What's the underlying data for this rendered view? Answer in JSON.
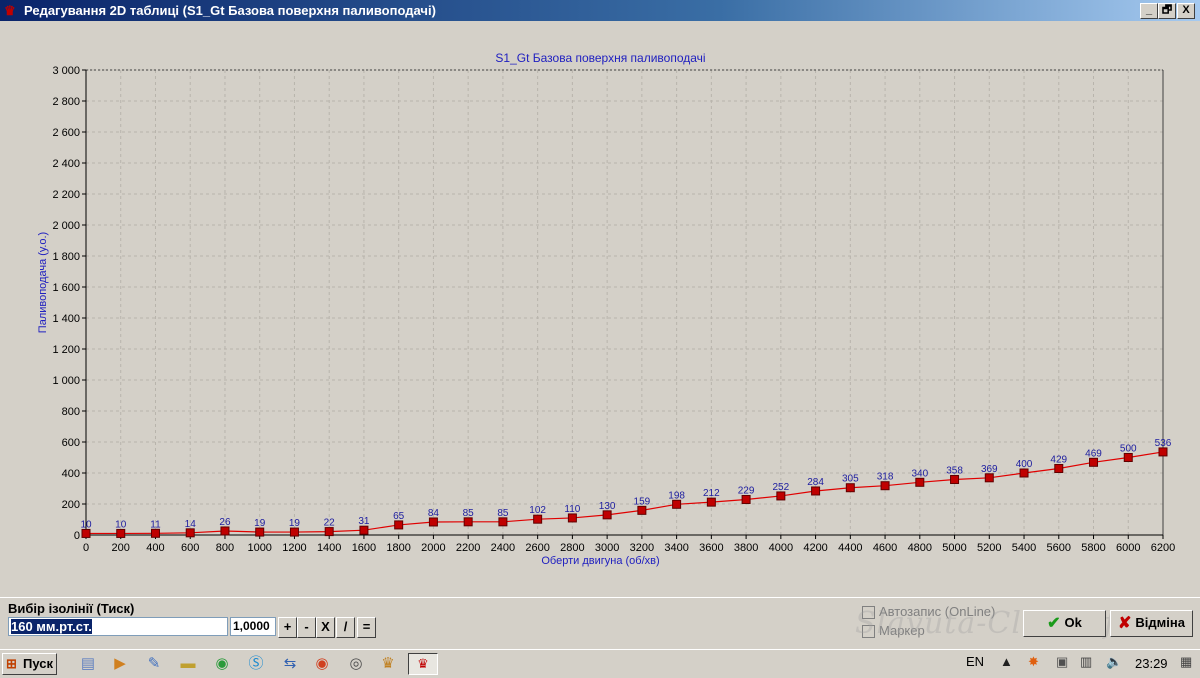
{
  "window": {
    "title": "Редагування 2D таблиці (S1_Gt Базова поверхня паливоподачі)",
    "icon": "crown-icon",
    "buttons": [
      "_",
      "🗗",
      "X"
    ]
  },
  "chart_data": {
    "type": "line",
    "title": "S1_Gt Базова поверхня паливоподачі",
    "xlabel": "Оберти двигуна (об/хв)",
    "ylabel": "Паливоподача (у.о.)",
    "x": [
      0,
      200,
      400,
      600,
      800,
      1000,
      1200,
      1400,
      1600,
      1800,
      2000,
      2200,
      2400,
      2600,
      2800,
      3000,
      3200,
      3400,
      3600,
      3800,
      4000,
      4200,
      4400,
      4600,
      4800,
      5000,
      5200,
      5400,
      5600,
      5800,
      6000,
      6200
    ],
    "series": [
      {
        "values": [
          10,
          10,
          11,
          14,
          26,
          19,
          19,
          22,
          31,
          65,
          84,
          85,
          85,
          102,
          110,
          130,
          159,
          198,
          212,
          229,
          252,
          284,
          305,
          318,
          340,
          358,
          369,
          400,
          429,
          469,
          500,
          536
        ]
      }
    ],
    "xlim": [
      0,
      6200
    ],
    "ylim": [
      0,
      3000
    ],
    "x_ticks": [
      "0",
      "200",
      "400",
      "600",
      "800",
      "1000",
      "1200",
      "1400",
      "1600",
      "1800",
      "2000",
      "2200",
      "2400",
      "2600",
      "2800",
      "3000",
      "3200",
      "3400",
      "3600",
      "3800",
      "4000",
      "4200",
      "4400",
      "4600",
      "4800",
      "5000",
      "5200",
      "5400",
      "5600",
      "5800",
      "6000",
      "6200"
    ],
    "y_ticks": [
      "0",
      "200",
      "400",
      "600",
      "800",
      "1 000",
      "1 200",
      "1 400",
      "1 600",
      "1 800",
      "2 000",
      "2 200",
      "2 400",
      "2 600",
      "2 800",
      "3 000"
    ],
    "grid": true,
    "line_color": "#e00000",
    "marker_color": "#c00000",
    "label_color": "#2020a0"
  },
  "isoline": {
    "label": "Вибір ізолінії (Тиск)",
    "selected": "160 мм.рт.ст.",
    "value": "1,0000",
    "ops": [
      "+",
      "-",
      "X",
      "/",
      "="
    ]
  },
  "options": {
    "autosave_label": "Автозапис (OnLine)",
    "marker_label": "Маркер"
  },
  "dialog_buttons": {
    "ok": "Ok",
    "cancel": "Відміна"
  },
  "watermark": "Slavuta-Club.info",
  "taskbar": {
    "start_label": "Пуск",
    "language": "EN",
    "clock": "23:29"
  }
}
